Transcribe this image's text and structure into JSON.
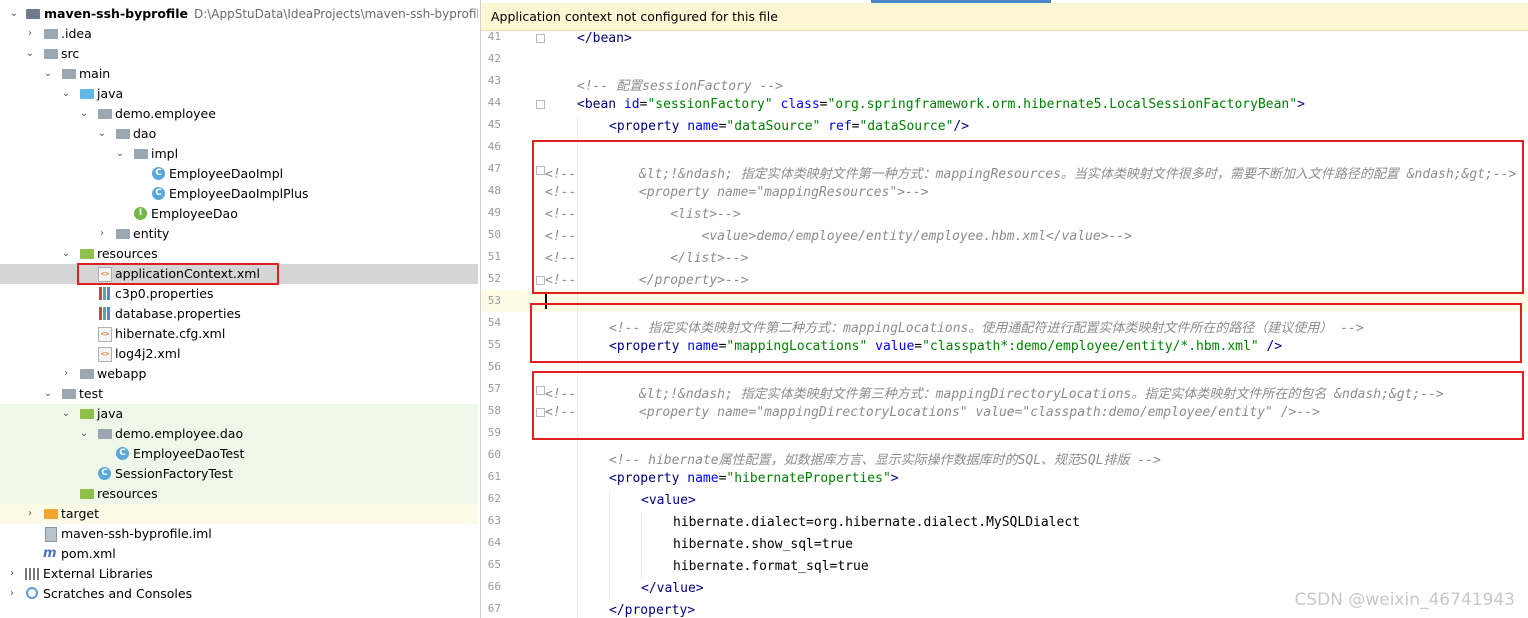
{
  "project_tree": {
    "root": {
      "name": "maven-ssh-byprofile",
      "path": "D:\\AppStuData\\IdeaProjects\\maven-ssh-byprofile"
    },
    "items": [
      {
        "label": "maven-ssh-byprofile"
      },
      {
        "label": ".idea"
      },
      {
        "label": "src"
      },
      {
        "label": "main"
      },
      {
        "label": "java"
      },
      {
        "label": "demo.employee"
      },
      {
        "label": "dao"
      },
      {
        "label": "impl"
      },
      {
        "label": "EmployeeDaoImpl"
      },
      {
        "label": "EmployeeDaoImplPlus"
      },
      {
        "label": "EmployeeDao"
      },
      {
        "label": "entity"
      },
      {
        "label": "resources"
      },
      {
        "label": "applicationContext.xml"
      },
      {
        "label": "c3p0.properties"
      },
      {
        "label": "database.properties"
      },
      {
        "label": "hibernate.cfg.xml"
      },
      {
        "label": "log4j2.xml"
      },
      {
        "label": "webapp"
      },
      {
        "label": "test"
      },
      {
        "label": "java"
      },
      {
        "label": "demo.employee.dao"
      },
      {
        "label": "EmployeeDaoTest"
      },
      {
        "label": "SessionFactoryTest"
      },
      {
        "label": "resources"
      },
      {
        "label": "target"
      },
      {
        "label": "maven-ssh-byprofile.iml"
      },
      {
        "label": "pom.xml"
      },
      {
        "label": "External Libraries"
      },
      {
        "label": "Scratches and Consoles"
      }
    ]
  },
  "editor": {
    "banner": "Application context not configured for this file",
    "line_numbers": [
      "41",
      "42",
      "43",
      "44",
      "45",
      "46",
      "47",
      "48",
      "49",
      "50",
      "51",
      "52",
      "53",
      "54",
      "55",
      "56",
      "57",
      "58",
      "59",
      "60",
      "61",
      "62",
      "63",
      "64",
      "65",
      "66",
      "67"
    ]
  },
  "watermark": "CSDN @weixin_46741943"
}
